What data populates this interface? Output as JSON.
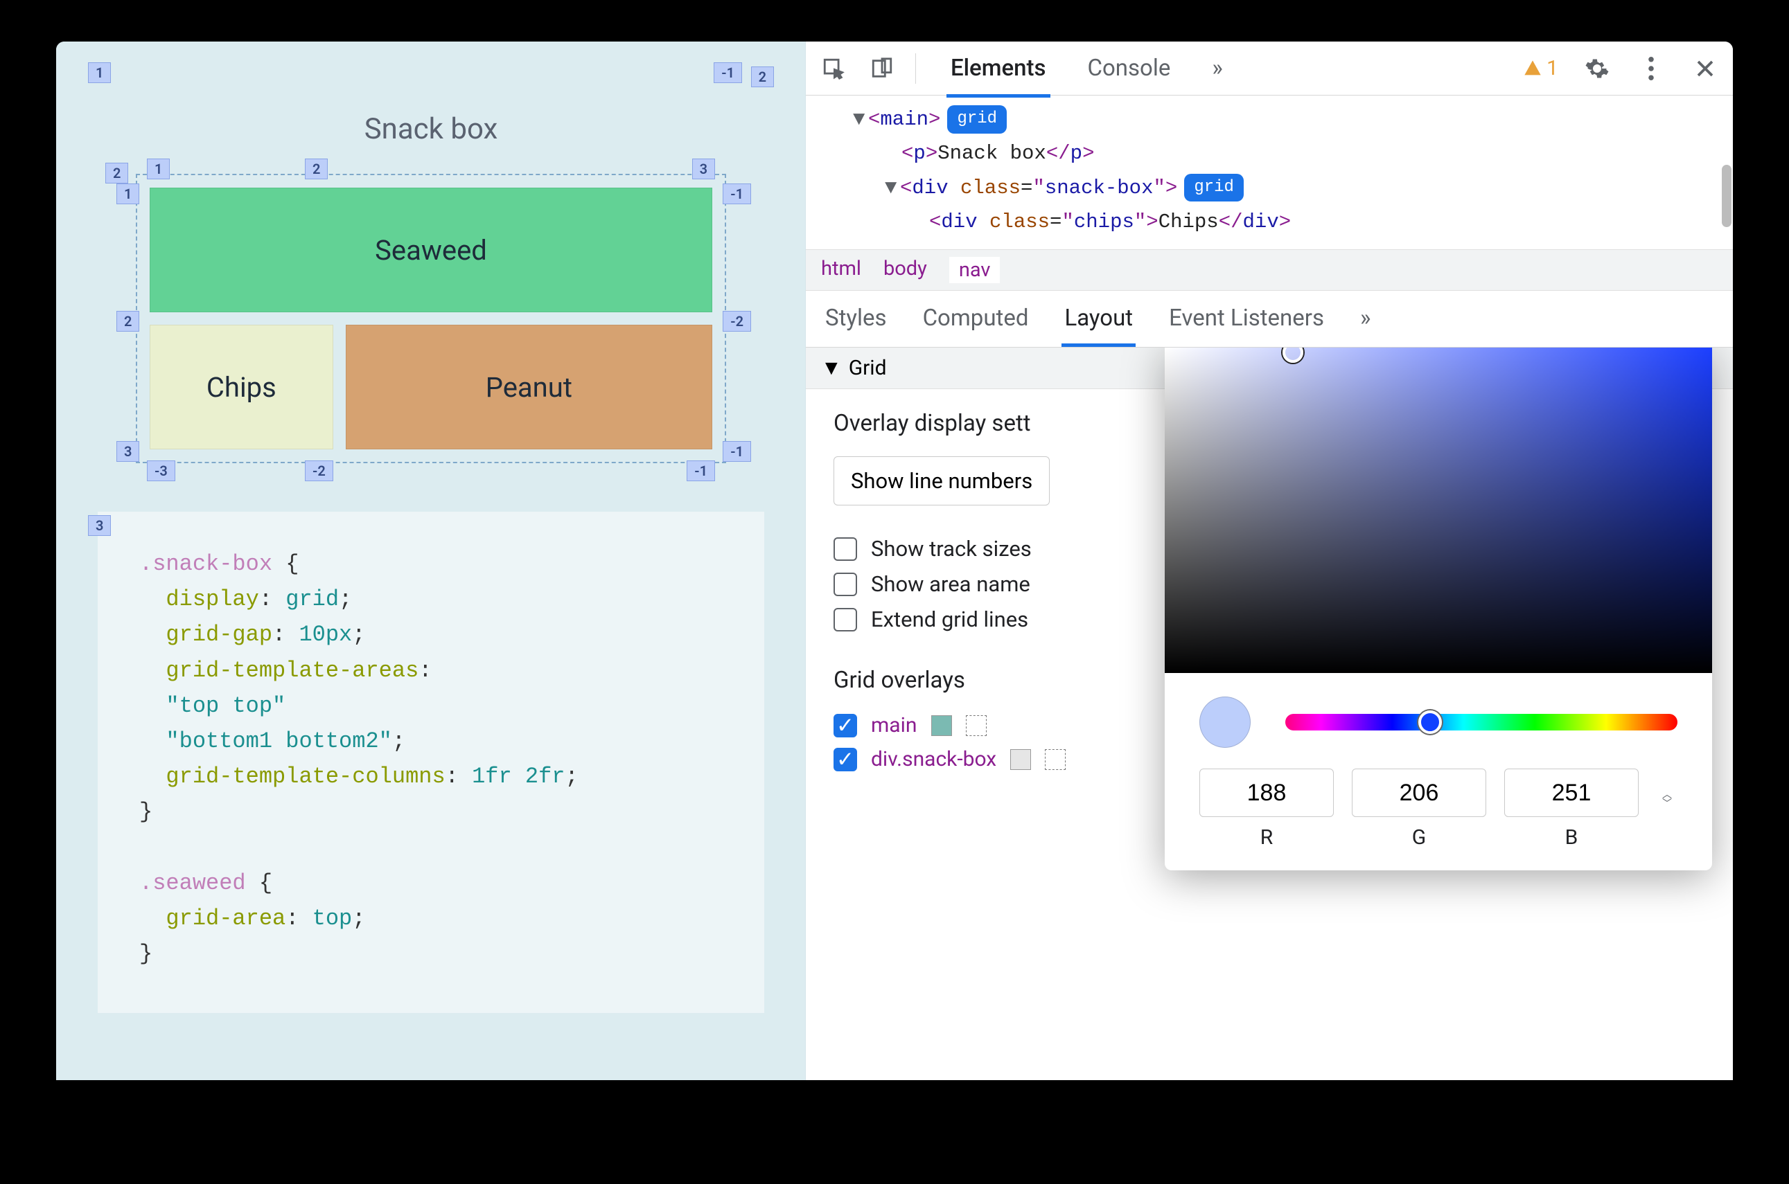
{
  "viewport": {
    "title": "Snack box",
    "cells": {
      "seaweed": "Seaweed",
      "chips": "Chips",
      "peanut": "Peanut"
    },
    "outer_markers": {
      "tl": "1",
      "tr": "-1",
      "tr2": "2",
      "bl": "3"
    },
    "inner_markers_top": [
      "1",
      "2",
      "3"
    ],
    "inner_markers_left": [
      "1",
      "2",
      "3"
    ],
    "inner_markers_right_top": "-1",
    "inner_markers_right_mid": "-2",
    "inner_markers_right_bot": "-1",
    "inner_markers_bottom": [
      "-3",
      "-2",
      "-1"
    ],
    "code_lines": [
      {
        "sel": ".snack-box",
        "open": " {"
      },
      {
        "prop": "display",
        "val": "grid"
      },
      {
        "prop": "grid-gap",
        "val": "10px"
      },
      {
        "prop": "grid-template-areas",
        "val": ""
      },
      {
        "lit": "\"top top\""
      },
      {
        "lit": "\"bottom1 bottom2\"",
        "term": ";"
      },
      {
        "prop": "grid-template-columns",
        "val": "1fr 2fr"
      },
      {
        "close": "}"
      },
      {
        "blank": true
      },
      {
        "sel": ".seaweed",
        "open": " {"
      },
      {
        "prop": "grid-area",
        "val": "top"
      },
      {
        "close": "}"
      }
    ]
  },
  "devtools": {
    "tabs": [
      "Elements",
      "Console"
    ],
    "active_tab": "Elements",
    "warning_count": "1",
    "dom": {
      "l1": {
        "tag": "main",
        "badge": "grid"
      },
      "l2": {
        "tag": "p",
        "text": "Snack box"
      },
      "l3": {
        "tag": "div",
        "class": "snack-box",
        "badge": "grid"
      },
      "l4": {
        "tag": "div",
        "class": "chips",
        "text": "Chips"
      }
    },
    "breadcrumb": [
      "html",
      "body",
      "nav"
    ],
    "panel_tabs": [
      "Styles",
      "Computed",
      "Layout",
      "Event Listeners"
    ],
    "active_panel_tab": "Layout",
    "grid_section": "Grid",
    "overlay_settings_title": "Overlay display sett",
    "line_numbers_select": "Show line numbers",
    "checkboxes": [
      {
        "label": "Show track sizes",
        "checked": false
      },
      {
        "label": "Show area name",
        "checked": false
      },
      {
        "label": "Extend grid lines",
        "checked": false
      }
    ],
    "overlays_title": "Grid overlays",
    "overlays": [
      {
        "name": "main",
        "checked": true,
        "swatch": "#7bbab2"
      },
      {
        "name": "div.snack-box",
        "checked": true,
        "swatch": "#e6e6e6"
      }
    ]
  },
  "color_picker": {
    "r": "188",
    "g": "206",
    "b": "251",
    "labels": {
      "r": "R",
      "g": "G",
      "b": "B"
    }
  }
}
